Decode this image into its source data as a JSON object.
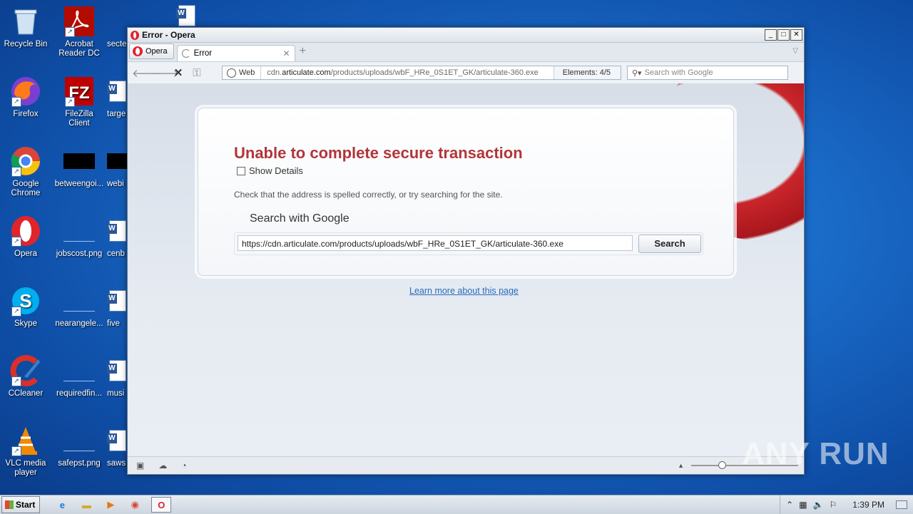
{
  "desktop": {
    "icons": [
      {
        "label": "Recycle Bin"
      },
      {
        "label": "Acrobat Reader DC"
      },
      {
        "label": "secte"
      },
      {
        "label": "Firefox"
      },
      {
        "label": "FileZilla Client"
      },
      {
        "label": "targe"
      },
      {
        "label": "Google Chrome"
      },
      {
        "label": "betweengoi..."
      },
      {
        "label": "webi"
      },
      {
        "label": "Opera"
      },
      {
        "label": "jobscost.png"
      },
      {
        "label": "cenb"
      },
      {
        "label": "Skype"
      },
      {
        "label": "nearangele..."
      },
      {
        "label": "five"
      },
      {
        "label": "CCleaner"
      },
      {
        "label": "requiredfin..."
      },
      {
        "label": "musi"
      },
      {
        "label": "VLC media player"
      },
      {
        "label": "safepst.png"
      },
      {
        "label": "saws"
      }
    ]
  },
  "window": {
    "title": "Error - Opera",
    "opera_menu": "Opera",
    "tab_title": "Error",
    "address": {
      "scheme_label": "Web",
      "url_prefix": "cdn.",
      "url_domain": "articulate.com",
      "url_path": "/products/uploads/wbF_HRe_0S1ET_GK/articulate-360.exe",
      "elements": "Elements:  4/5"
    },
    "search_placeholder": "Search with Google"
  },
  "page": {
    "title": "Unable to complete secure transaction",
    "show_details": "Show Details",
    "hint": "Check that the address is spelled correctly, or try searching for the site.",
    "search_label": "Search with Google",
    "search_value": "https://cdn.articulate.com/products/uploads/wbF_HRe_0S1ET_GK/articulate-360.exe",
    "search_button": "Search",
    "learn_more": "Learn more about this page"
  },
  "watermark": "ANY RUN",
  "taskbar": {
    "start": "Start",
    "clock": "1:39 PM"
  },
  "colors": {
    "error_title": "#b1353a",
    "link": "#2a6bb8",
    "opera_red": "#c9262b"
  }
}
